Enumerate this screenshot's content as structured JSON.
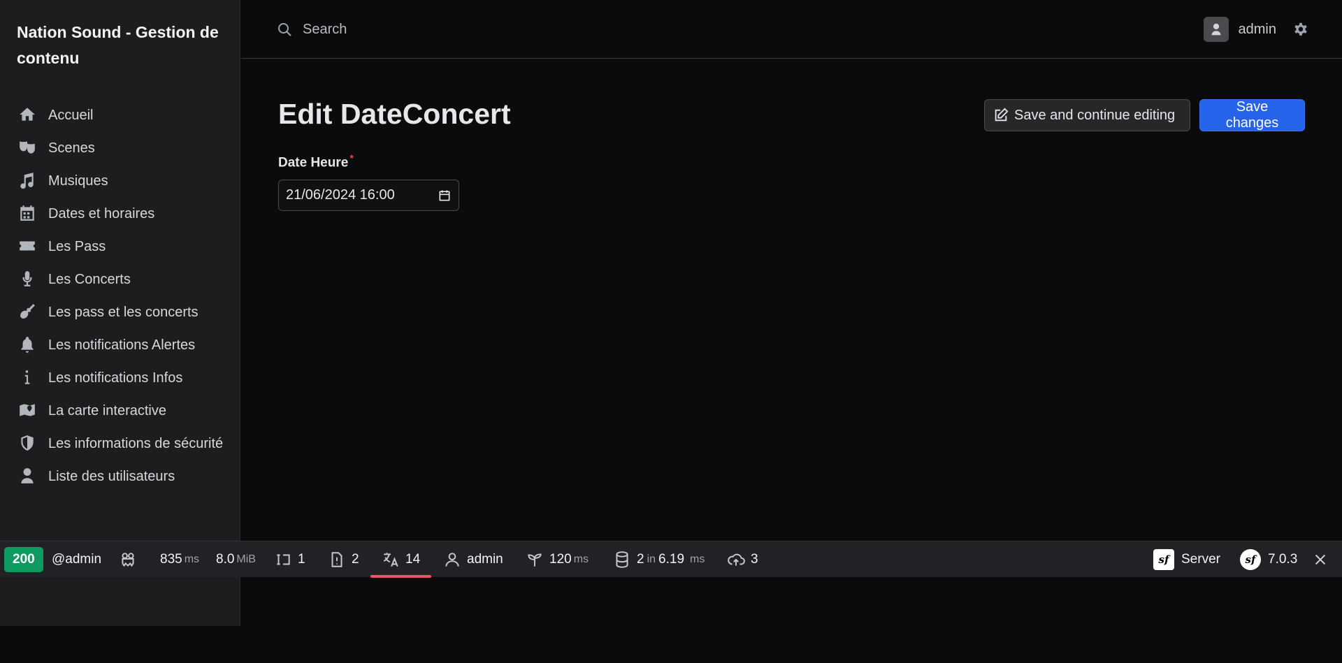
{
  "app": {
    "brand": "Nation Sound - Gestion de contenu"
  },
  "sidebar": {
    "items": [
      {
        "label": "Accueil",
        "icon": "home-icon"
      },
      {
        "label": "Scenes",
        "icon": "theater-masks-icon"
      },
      {
        "label": "Musiques",
        "icon": "music-icon"
      },
      {
        "label": "Dates et horaires",
        "icon": "calendar-icon"
      },
      {
        "label": "Les Pass",
        "icon": "ticket-icon"
      },
      {
        "label": "Les Concerts",
        "icon": "microphone-icon"
      },
      {
        "label": "Les pass et les concerts",
        "icon": "guitar-icon"
      },
      {
        "label": "Les notifications Alertes",
        "icon": "bell-icon"
      },
      {
        "label": "Les notifications Infos",
        "icon": "info-icon"
      },
      {
        "label": "La carte interactive",
        "icon": "map-icon"
      },
      {
        "label": "Les informations de sécurité",
        "icon": "shield-icon"
      },
      {
        "label": "Liste des utilisateurs",
        "icon": "user-icon"
      }
    ]
  },
  "topbar": {
    "search_placeholder": "Search",
    "user_name": "admin"
  },
  "main": {
    "title": "Edit DateConcert",
    "save_continue_label": "Save and continue editing",
    "save_label": "Save changes",
    "field_label": "Date Heure",
    "field_required_mark": "*",
    "field_value": "21/06/2024 16:00"
  },
  "debug_toolbar": {
    "status_code": "200",
    "route": "@admin",
    "time_value": "835",
    "time_unit": "ms",
    "memory_value": "8.0",
    "memory_unit": "MiB",
    "forms_count": "1",
    "validator_count": "2",
    "translation_count": "14",
    "user": "admin",
    "twig_value": "120",
    "twig_unit": "ms",
    "db_queries": "2",
    "db_in": "in",
    "db_time": "6.19",
    "db_unit": "ms",
    "http_count": "3",
    "server_label": "Server",
    "symfony_version": "7.0.3",
    "status_color": "#0f9a5f",
    "active_underline_color": "#e4566c"
  }
}
